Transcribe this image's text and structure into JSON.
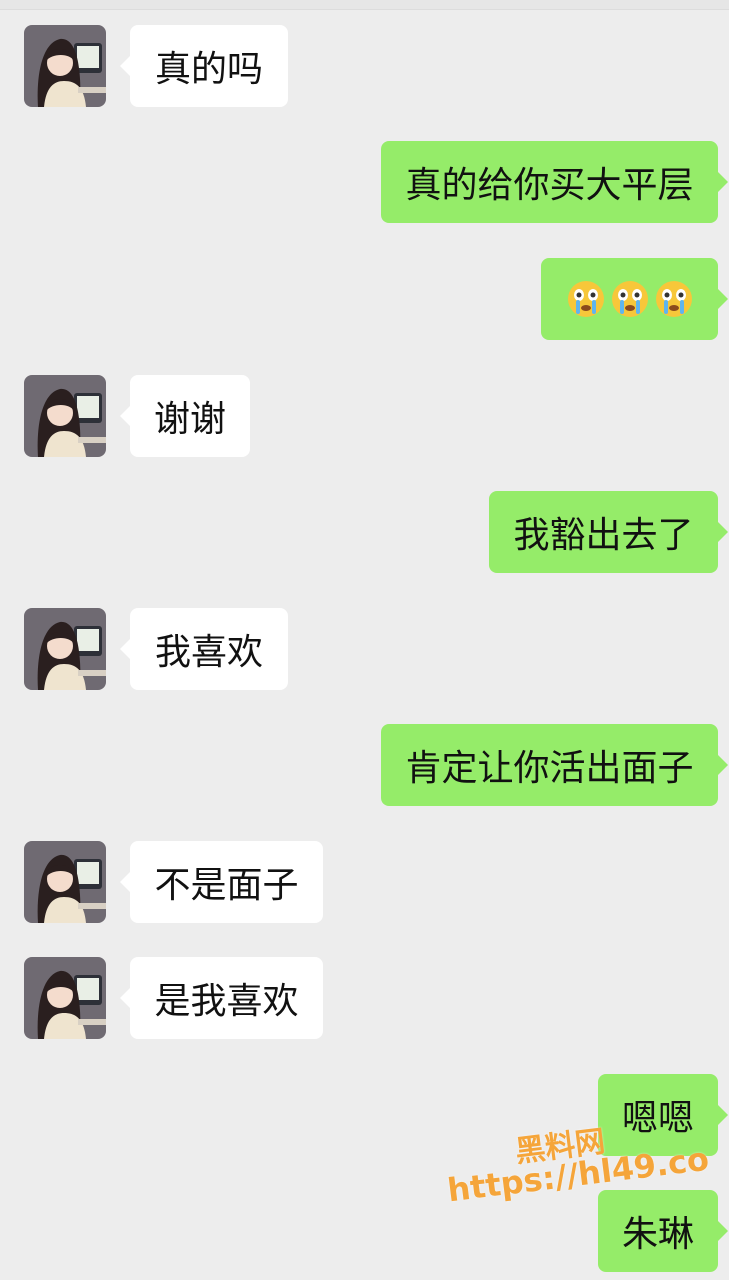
{
  "messages": [
    {
      "side": "left",
      "text": "真的吗"
    },
    {
      "side": "right",
      "text": "真的给你买大平层"
    },
    {
      "side": "right",
      "emoji": [
        "crying-emoji",
        "crying-emoji",
        "crying-emoji"
      ]
    },
    {
      "side": "left",
      "text": "谢谢"
    },
    {
      "side": "right",
      "text": "我豁出去了"
    },
    {
      "side": "left",
      "text": "我喜欢"
    },
    {
      "side": "right",
      "text": "肯定让你活出面子"
    },
    {
      "side": "left",
      "text": "不是面子"
    },
    {
      "side": "left",
      "text": "是我喜欢"
    },
    {
      "side": "right",
      "text": "嗯嗯"
    },
    {
      "side": "right",
      "text": "朱琳"
    }
  ],
  "watermark": {
    "line1": "黑料网",
    "line2": "https://hl49.co"
  },
  "colors": {
    "background": "#ededed",
    "sent_bubble": "#95ec69",
    "received_bubble": "#ffffff",
    "watermark": "#f5a53a"
  }
}
